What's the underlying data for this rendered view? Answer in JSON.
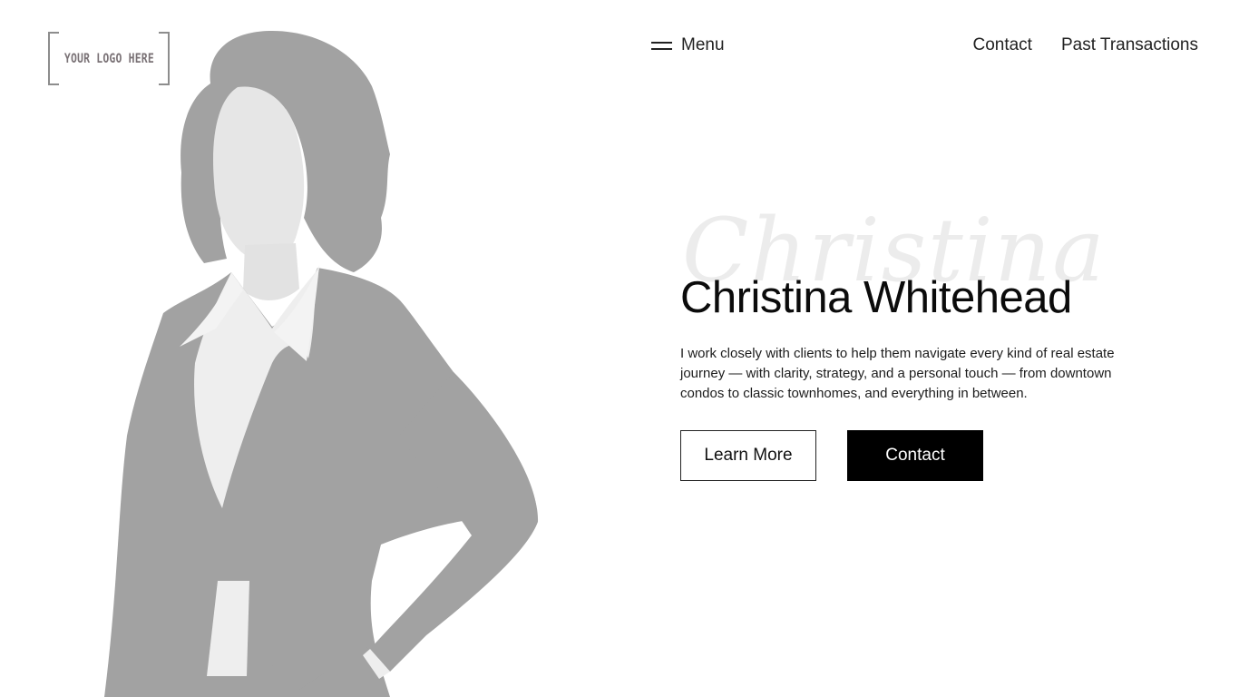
{
  "logo": {
    "text": "YOUR LOGO HERE"
  },
  "nav": {
    "menu_label": "Menu",
    "menu_icon": "hamburger-icon",
    "links": [
      "Contact",
      "Past Transactions"
    ]
  },
  "hero": {
    "script_name": "Christina",
    "title": "Christina Whitehead",
    "description": "I work closely with clients to help them navigate every kind of real estate journey — with clarity, strategy, and a personal touch — from downtown condos to classic townhomes, and everything in between.",
    "learn_more_label": "Learn More",
    "contact_label": "Contact"
  },
  "colors": {
    "background": "#ffffff",
    "accent": "#000000",
    "silhouette_suit": "#a2a2a2",
    "silhouette_shirt": "#eeeeee"
  }
}
